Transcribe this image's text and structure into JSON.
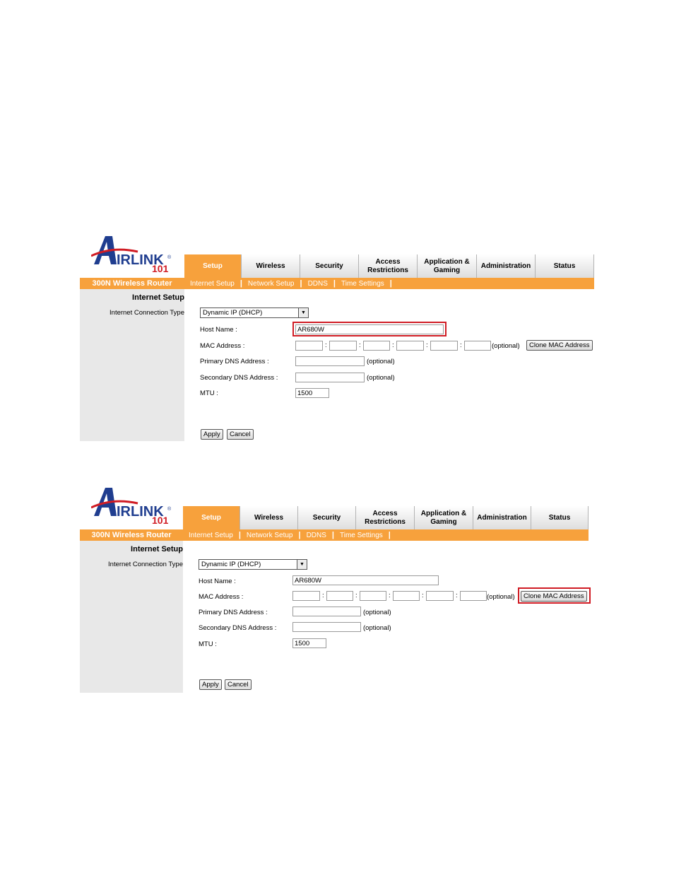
{
  "screens": [
    {
      "logo": {
        "text": "IRLINK",
        "number": "101",
        "registered": "®"
      },
      "tabs": [
        "Setup",
        "Wireless",
        "Security",
        "Access Restrictions",
        "Application & Gaming",
        "Administration",
        "Status"
      ],
      "active_tab": "Setup",
      "product_title": "300N Wireless Router",
      "subnav": [
        "Internet Setup",
        "Network Setup",
        "DDNS",
        "Time Settings"
      ],
      "section_title": "Internet Setup",
      "connection_type_label": "Internet Connection Type",
      "connection_type_value": "Dynamic IP (DHCP)",
      "host_name_label": "Host Name :",
      "host_name_value": "AR680W",
      "mac_label": "MAC Address :",
      "optional": "(optional)",
      "clone_mac_label": "Clone MAC Address",
      "primary_dns_label": "Primary DNS Address :",
      "secondary_dns_label": "Secondary DNS Address :",
      "mtu_label": "MTU :",
      "mtu_value": "1500",
      "apply_label": "Apply",
      "cancel_label": "Cancel",
      "highlighted": "host-name"
    },
    {
      "logo": {
        "text": "IRLINK",
        "number": "101",
        "registered": "®"
      },
      "tabs": [
        "Setup",
        "Wireless",
        "Security",
        "Access Restrictions",
        "Application & Gaming",
        "Administration",
        "Status"
      ],
      "active_tab": "Setup",
      "product_title": "300N Wireless Router",
      "subnav": [
        "Internet Setup",
        "Network Setup",
        "DDNS",
        "Time Settings"
      ],
      "section_title": "Internet Setup",
      "connection_type_label": "Internet Connection Type",
      "connection_type_value": "Dynamic IP (DHCP)",
      "host_name_label": "Host Name :",
      "host_name_value": "AR680W",
      "mac_label": "MAC Address :",
      "optional": "(optional)",
      "clone_mac_label": "Clone MAC Address",
      "primary_dns_label": "Primary DNS Address :",
      "secondary_dns_label": "Secondary DNS Address :",
      "mtu_label": "MTU :",
      "mtu_value": "1500",
      "apply_label": "Apply",
      "cancel_label": "Cancel",
      "highlighted": "clone-mac-button"
    }
  ],
  "colors": {
    "accent": "#f7a13c",
    "highlight": "#d01c24",
    "sidebar": "#e8e8e8",
    "logo_blue": "#1f3d8f",
    "logo_red": "#d01c24"
  }
}
